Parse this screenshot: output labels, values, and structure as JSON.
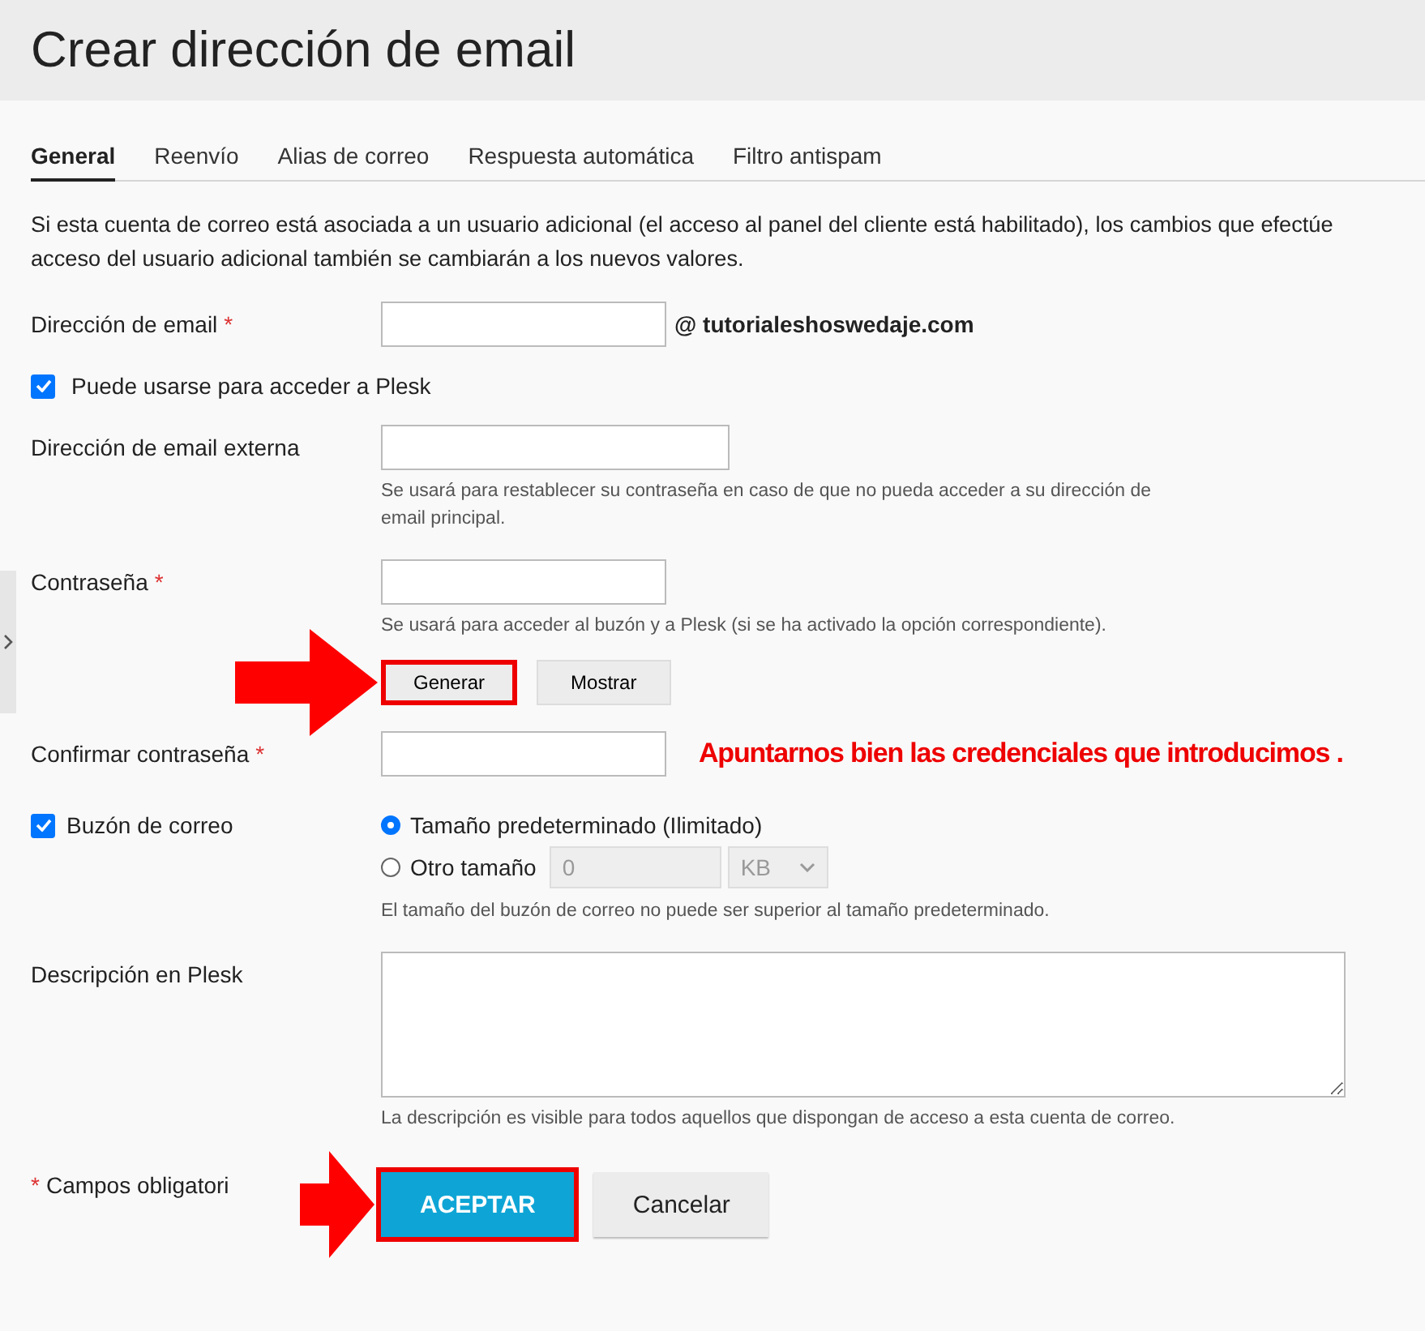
{
  "title": "Crear dirección de email",
  "tabs": [
    {
      "label": "General",
      "selected": true
    },
    {
      "label": "Reenvío",
      "selected": false
    },
    {
      "label": "Alias de correo",
      "selected": false
    },
    {
      "label": "Respuesta automática",
      "selected": false
    },
    {
      "label": "Filtro antispam",
      "selected": false
    }
  ],
  "intro": [
    "Si esta cuenta de correo está asociada a un usuario adicional (el acceso al panel del cliente está habilitado), los cambios que efectúe",
    "acceso del usuario adicional también se cambiarán a los nuevos valores."
  ],
  "fields": [
    {
      "kind": "email",
      "label": "Dirección de email",
      "required_mark": "*",
      "suffix": "@ tutorialeshoswedaje.com"
    },
    {
      "kind": "checkbox",
      "label": "Puede usarse para acceder a Plesk",
      "checked": true
    },
    {
      "kind": "text",
      "label": "Dirección de email externa",
      "hint": "Se usará para restablecer su contraseña en caso de que no pueda acceder a su dirección de email principal."
    },
    {
      "kind": "password",
      "label": "Contraseña",
      "required_mark": "*",
      "hint": "Se usará para acceder al buzón y a Plesk (si se ha activado la opción correspondiente).",
      "buttons": [
        {
          "label": "Generar",
          "highlighted": true
        },
        {
          "label": "Mostrar",
          "highlighted": false
        }
      ]
    },
    {
      "kind": "confirm",
      "label": "Confirmar contraseña",
      "required_mark": "*",
      "note": "Apuntarnos bien las credenciales que introducimos ."
    },
    {
      "kind": "mailbox",
      "label": "Buzón de correo",
      "checked": true,
      "options": [
        {
          "label": "Tamaño predeterminado (Ilimitado)",
          "selected": true
        },
        {
          "label": "Otro tamaño",
          "selected": false,
          "value": "0",
          "unit": "KB"
        }
      ],
      "hint": "El tamaño del buzón de correo no puede ser superior al tamaño predeterminado."
    },
    {
      "kind": "textarea",
      "label": "Descripción en Plesk",
      "hint": "La descripción es visible para todos aquellos que dispongan de acceso a esta cuenta de correo."
    }
  ],
  "footer": {
    "required_mark": "*",
    "required_label": "Campos obligatori",
    "buttons": [
      {
        "label": "ACEPTAR",
        "kind": "primary",
        "highlighted": true
      },
      {
        "label": "Cancelar",
        "kind": "secondary",
        "highlighted": false
      }
    ]
  }
}
